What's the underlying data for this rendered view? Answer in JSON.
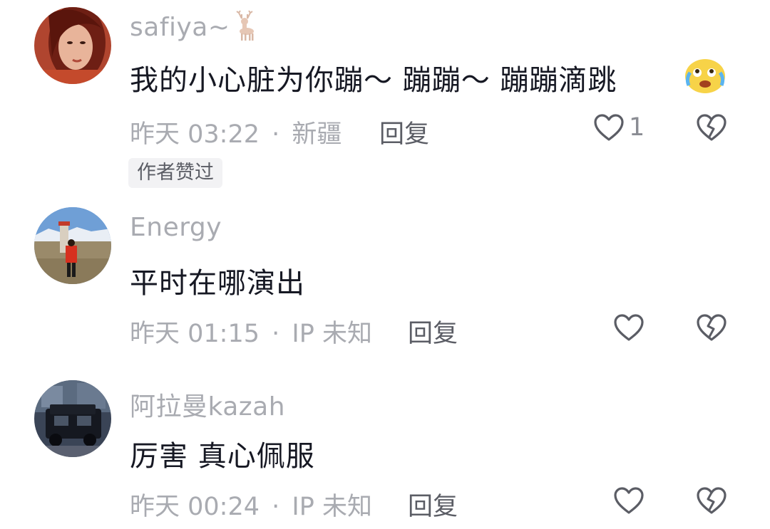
{
  "comments": [
    {
      "username": "safiya~",
      "username_icon": "deer-icon",
      "text": "我的小心脏为你蹦～ 蹦蹦～ 蹦蹦滴跳",
      "text_emoji": "crying-laughing-emoji",
      "time": "昨天 03:22",
      "separator": "·",
      "location": "新疆",
      "reply_label": "回复",
      "like_count": "1",
      "author_tag": "作者赞过"
    },
    {
      "username": "Energy",
      "text": "平时在哪演出",
      "time": "昨天 01:15",
      "separator": "·",
      "location": "IP 未知",
      "reply_label": "回复"
    },
    {
      "username": "阿拉曼kazah",
      "text": "厉害 真心佩服",
      "time": "昨天 00:24",
      "separator": "·",
      "location": "IP 未知",
      "reply_label": "回复"
    }
  ],
  "colors": {
    "username": "#a9abb1",
    "text": "#161823",
    "meta": "#a9abb1",
    "reply": "#5b5d65",
    "tag_bg": "#f2f2f4"
  },
  "icons": {
    "like": "heart-outline-icon",
    "dislike": "broken-heart-icon"
  }
}
